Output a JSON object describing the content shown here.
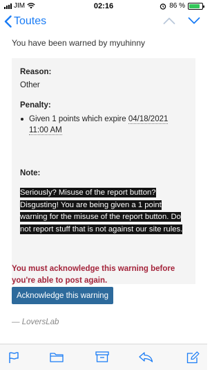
{
  "status_bar": {
    "carrier": "JIM",
    "time": "02:16",
    "battery_percent": "86 %",
    "battery_level": 0.86,
    "battery_color": "#34c759"
  },
  "navbar": {
    "back_label": "Toutes",
    "accent_color": "#1a7cf5"
  },
  "message": {
    "warned_by": "You have been warned by myuhinny",
    "reason_label": "Reason:",
    "reason_value": "Other",
    "penalty_label": "Penalty:",
    "penalty_prefix": "Given 1 points which expire ",
    "penalty_date": "04/18/2021 11:00 AM",
    "note_label": "Note:",
    "note_text": "Seriously? Misuse of the report button? Disgusting! You are being given a 1 point warning for the misuse of the report button. Do not report stuff that is not against our site rules.",
    "must_acknowledge": "You must acknowledge this warning before you're able to post again.",
    "acknowledge_button": "Acknowledge this warning",
    "signature": "— LoversLab"
  },
  "colors": {
    "alert_red": "#a4243b",
    "button_blue": "#2d6a9c",
    "toolbar_blue": "#1a7cf5"
  },
  "toolbar": {
    "icons": [
      "flag-icon",
      "folder-icon",
      "archive-icon",
      "reply-icon",
      "compose-icon"
    ]
  }
}
